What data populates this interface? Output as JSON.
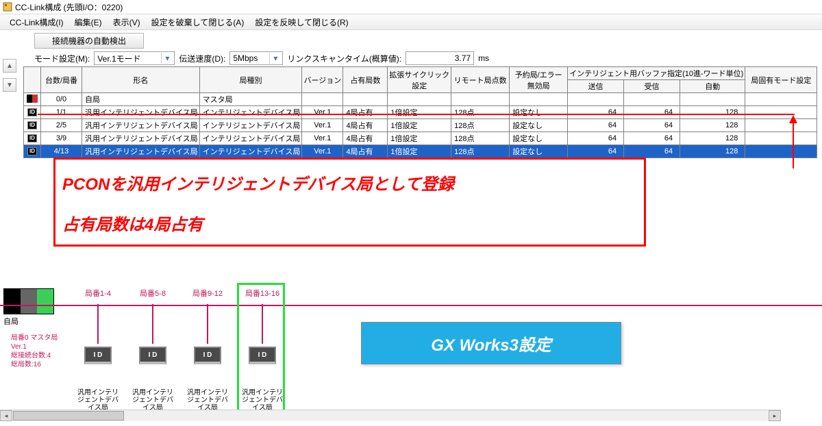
{
  "window": {
    "title": "CC-Link構成 (先頭I/O：0220)"
  },
  "menu": {
    "config": "CC-Link構成(I)",
    "edit": "編集(E)",
    "view": "表示(V)",
    "discard_close": "設定を破棄して閉じる(A)",
    "apply_close": "設定を反映して閉じる(R)"
  },
  "toolbar": {
    "autodetect": "接続機器の自動検出",
    "mode_label": "モード設定(M):",
    "mode_value": "Ver.1モード",
    "baud_label": "伝送速度(D):",
    "baud_value": "5Mbps",
    "lscan_label": "リンクスキャンタイム(概算値):",
    "lscan_value": "3.77",
    "lscan_unit": "ms"
  },
  "headers": {
    "count": "台数/局番",
    "model": "形名",
    "type": "局種別",
    "ver": "バージョン",
    "occ": "占有局数",
    "ext": "拡張サイクリック\n設定",
    "remote": "リモート局点数",
    "reserve": "予約局/エラー\n無効局",
    "intel": "インテリジェント用バッファ指定(10進-ワード単位)",
    "send": "送信",
    "recv": "受信",
    "auto": "自動",
    "fixmode": "局固有モード設定"
  },
  "rows": [
    {
      "id": "0/0",
      "model": "自局",
      "type": "マスタ局",
      "ver": "",
      "occ": "",
      "ext": "",
      "remote": "",
      "reserve": "",
      "send": "",
      "recv": "",
      "auto": "",
      "fix": "",
      "sel": false,
      "icon": "master"
    },
    {
      "id": "1/1",
      "model": "汎用インテリジェントデバイス局",
      "type": "インテリジェントデバイス局",
      "ver": "Ver.1",
      "occ": "4局占有",
      "ext": "1倍設定",
      "remote": "128点",
      "reserve": "設定なし",
      "send": "64",
      "recv": "64",
      "auto": "128",
      "fix": "",
      "sel": false,
      "icon": "id"
    },
    {
      "id": "2/5",
      "model": "汎用インテリジェントデバイス局",
      "type": "インテリジェントデバイス局",
      "ver": "Ver.1",
      "occ": "4局占有",
      "ext": "1倍設定",
      "remote": "128点",
      "reserve": "設定なし",
      "send": "64",
      "recv": "64",
      "auto": "128",
      "fix": "",
      "sel": false,
      "icon": "id"
    },
    {
      "id": "3/9",
      "model": "汎用インテリジェントデバイス局",
      "type": "インテリジェントデバイス局",
      "ver": "Ver.1",
      "occ": "4局占有",
      "ext": "1倍設定",
      "remote": "128点",
      "reserve": "設定なし",
      "send": "64",
      "recv": "64",
      "auto": "128",
      "fix": "",
      "sel": false,
      "icon": "id"
    },
    {
      "id": "4/13",
      "model": "汎用インテリジェントデバイス局",
      "type": "インテリジェントデバイス局",
      "ver": "Ver.1",
      "occ": "4局占有",
      "ext": "1倍設定",
      "remote": "128点",
      "reserve": "設定なし",
      "send": "64",
      "recv": "64",
      "auto": "128",
      "fix": "",
      "sel": true,
      "icon": "id"
    }
  ],
  "annotation": {
    "line1": "PCONを汎用インテリジェントデバイス局として登録",
    "line2": "占有局数は4局占有"
  },
  "topology": {
    "master": "自局",
    "info": "局番0 マスタ局\nVer.1\n総接続台数:4\n総局数:16",
    "nodes": [
      {
        "range": "局番1-4",
        "chip": "I D",
        "type": "汎用インテリ\nジェントデバ\nイス局"
      },
      {
        "range": "局番5-8",
        "chip": "I D",
        "type": "汎用インテリ\nジェントデバ\nイス局"
      },
      {
        "range": "局番9-12",
        "chip": "I D",
        "type": "汎用インテリ\nジェントデバ\nイス局"
      },
      {
        "range": "局番13-16",
        "chip": "I D",
        "type": "汎用インテリ\nジェントデバ\nイス局"
      }
    ]
  },
  "gx": {
    "label": "GX Works3設定"
  }
}
